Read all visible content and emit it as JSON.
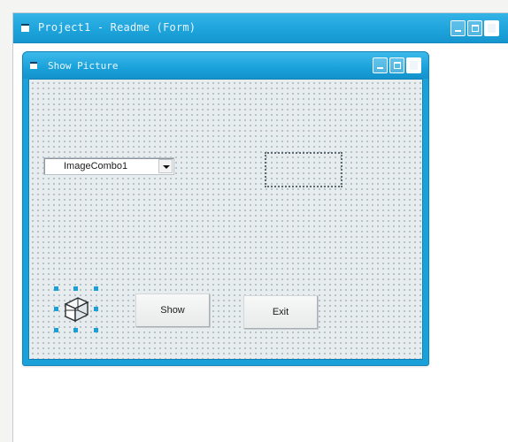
{
  "outer_window": {
    "title": "Project1 - Readme (Form)"
  },
  "form": {
    "title": "Show Picture",
    "imagecombo": {
      "text": "ImageCombo1"
    },
    "buttons": {
      "show_label": "Show",
      "exit_label": "Exit"
    }
  },
  "colors": {
    "titlebar_blue": "#1ea4dc",
    "form_border_blue": "#1aa1da",
    "grid_dot": "#a9b6be",
    "selection_handle": "#1a9ed8"
  },
  "icons": {
    "system_menu": "window-icon",
    "minimize": "minimize-icon",
    "maximize": "maximize-icon",
    "close": "close-icon",
    "combo_arrow": "chevron-down-icon",
    "common_dialog": "common-dialog-cube-icon"
  }
}
